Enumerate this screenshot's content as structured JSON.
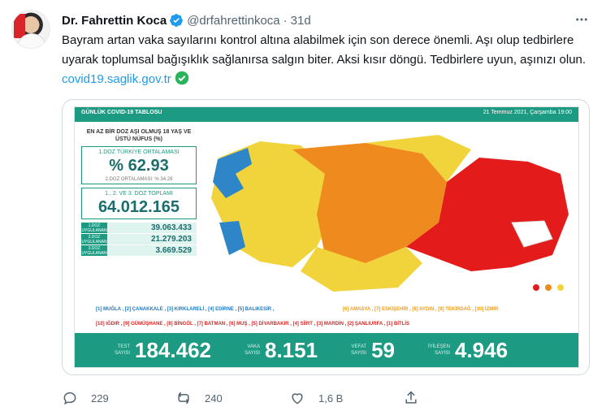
{
  "tweet": {
    "name": "Dr. Fahrettin Koca",
    "handle": "@drfahrettinkoca",
    "separator": "·",
    "time": "31d",
    "text_main": "Bayram artan vaka sayılarını kontrol altına alabilmek için son derece önemli. Aşı olup tedbirlere uyarak toplumsal bağışıklık sağlanırsa salgın biter. Aksi kısır döngü. Tedbirlere uyun, aşınızı olun. ",
    "link": "covid19.saglik.gov.tr"
  },
  "infographic": {
    "header_title": "GÜNLÜK COVID-19 TABLOSU",
    "header_date": "21 Temmuz 2021, Çarşamba 19:00",
    "stats_heading": "EN AZ BİR DOZ AŞI OLMUŞ 18 YAŞ VE ÜSTÜ NÜFUS (%)",
    "first_dose_label": "1.DOZ TÜRKİYE ORTALAMASI",
    "first_dose_value": "% 62.93",
    "second_dose_avg": "2.DOZ ORTALAMASI: % 34.28",
    "total_label": "1., 2. VE 3. DOZ TOPLAMI",
    "total_value": "64.012.165",
    "doses": [
      {
        "label": "1.DOZ UYGULANAN",
        "value": "39.063.433"
      },
      {
        "label": "2.DOZ UYGULANAN",
        "value": "21.279.203"
      },
      {
        "label": "3.DOZ UYGULANAN",
        "value": "3.669.529"
      }
    ],
    "legend_blue": "[1] MUĞLA , [2] ÇANAKKALE , [3] KIRKLARELİ , [4] EDİRNE , [5] BALIKESİR ,",
    "legend_orange": "[6] AMASYA , [7] ESKİŞEHİR , [8] AYDIN , [9] TEKİRDAĞ , [10] İZMİR",
    "legend_red": "[10] IĞDIR , [9] GÜMÜŞHANE , [8] BİNGÖL , [7] BATMAN , [6] MUŞ , [5] DİYARBAKIR , [4] SİİRT , [3] MARDİN , [2] ŞANLIURFA , [1] BİTLİS",
    "metrics": [
      {
        "label": "TEST SAYISI",
        "value": "184.462"
      },
      {
        "label": "VAKA SAYISI",
        "value": "8.151"
      },
      {
        "label": "VEFAT SAYISI",
        "value": "59"
      },
      {
        "label": "İYİLEŞEN SAYISI",
        "value": "4.946"
      }
    ],
    "colors": {
      "teal": "#1c9a82",
      "blue": "#2e86c8",
      "yellow": "#f1d33c",
      "orange": "#ef8a1e",
      "red": "#e31b1b"
    }
  },
  "actions": {
    "reply_count": "229",
    "retweet_count": "240",
    "like_count": "1,6 B",
    "icons": [
      "reply-icon",
      "retweet-icon",
      "like-icon",
      "share-icon"
    ]
  }
}
